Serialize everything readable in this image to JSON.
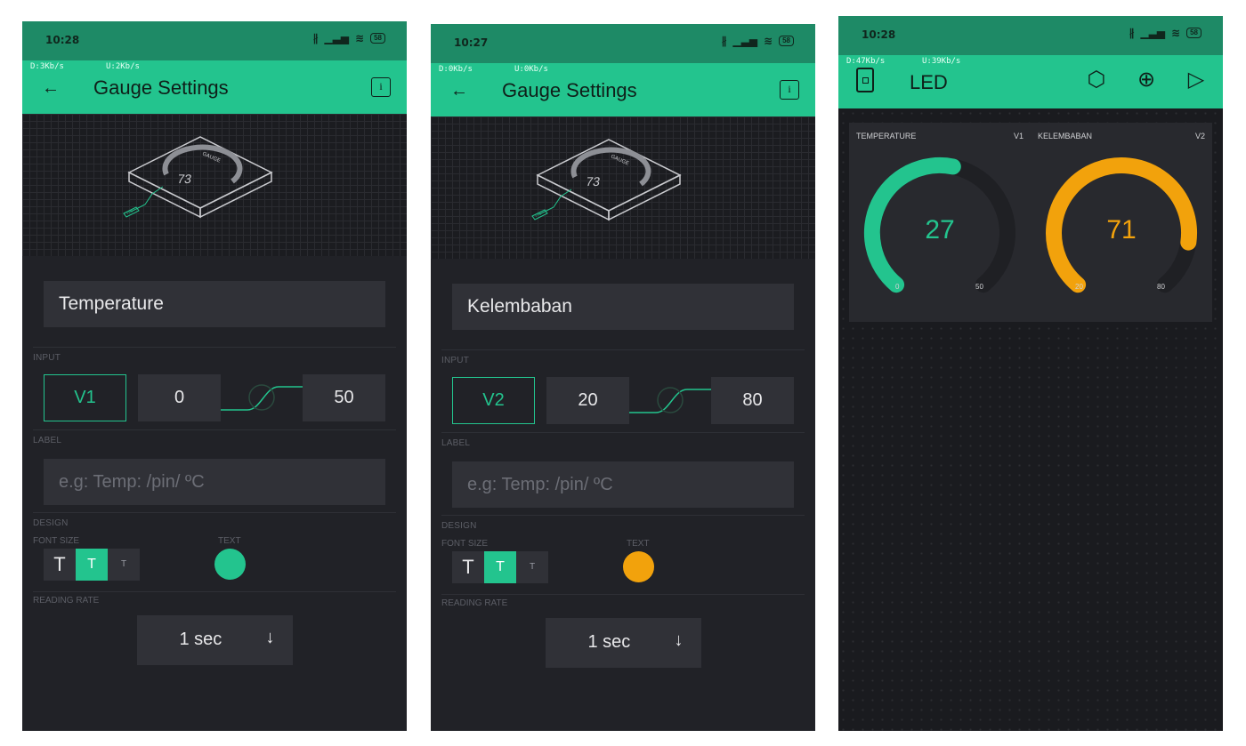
{
  "screens": [
    {
      "status": {
        "time": "10:28",
        "battery": "58"
      },
      "appbar": {
        "net_down": "D:3Kb/s",
        "net_up": "U:2Kb/s",
        "title": "Gauge Settings"
      },
      "preview": {
        "gauge_number": "73",
        "gauge_label": "GAUGE",
        "pin_label": "PIN"
      },
      "name": "Temperature",
      "input": {
        "section_label": "INPUT",
        "pin": "V1",
        "min": "0",
        "max": "50"
      },
      "label": {
        "section_label": "LABEL",
        "placeholder": "e.g: Temp: /pin/ ºC"
      },
      "design": {
        "section_label": "DESIGN",
        "font_size_label": "FONT SIZE",
        "text_label": "TEXT",
        "font_sizes": [
          "T",
          "T",
          "T"
        ],
        "text_color": "#23c48e"
      },
      "reading_rate": {
        "section_label": "READING RATE",
        "value": "1 sec"
      }
    },
    {
      "status": {
        "time": "10:27",
        "battery": "58"
      },
      "appbar": {
        "net_down": "D:0Kb/s",
        "net_up": "U:0Kb/s",
        "title": "Gauge Settings"
      },
      "preview": {
        "gauge_number": "73",
        "gauge_label": "GAUGE",
        "pin_label": "PIN"
      },
      "name": "Kelembaban",
      "input": {
        "section_label": "INPUT",
        "pin": "V2",
        "min": "20",
        "max": "80"
      },
      "label": {
        "section_label": "LABEL",
        "placeholder": "e.g: Temp: /pin/ ºC"
      },
      "design": {
        "section_label": "DESIGN",
        "font_size_label": "FONT SIZE",
        "text_label": "TEXT",
        "font_sizes": [
          "T",
          "T",
          "T"
        ],
        "text_color": "#f2a20c"
      },
      "reading_rate": {
        "section_label": "READING RATE",
        "value": "1 sec"
      }
    }
  ],
  "dashboard": {
    "status": {
      "time": "10:28",
      "battery": "58"
    },
    "appbar": {
      "net_down": "D:47Kb/s",
      "net_up": "U:39Kb/s",
      "title": "LED"
    },
    "icons": [
      "settings-icon",
      "add-icon",
      "play-icon"
    ],
    "gauges": [
      {
        "title": "TEMPERATURE",
        "pin": "V1",
        "value": "27",
        "min": "0",
        "max": "50",
        "fraction": 0.54,
        "color": "#23c48e"
      },
      {
        "title": "KELEMBABAN",
        "pin": "V2",
        "value": "71",
        "min": "20",
        "max": "80",
        "fraction": 0.85,
        "color": "#f2a20c"
      }
    ]
  }
}
